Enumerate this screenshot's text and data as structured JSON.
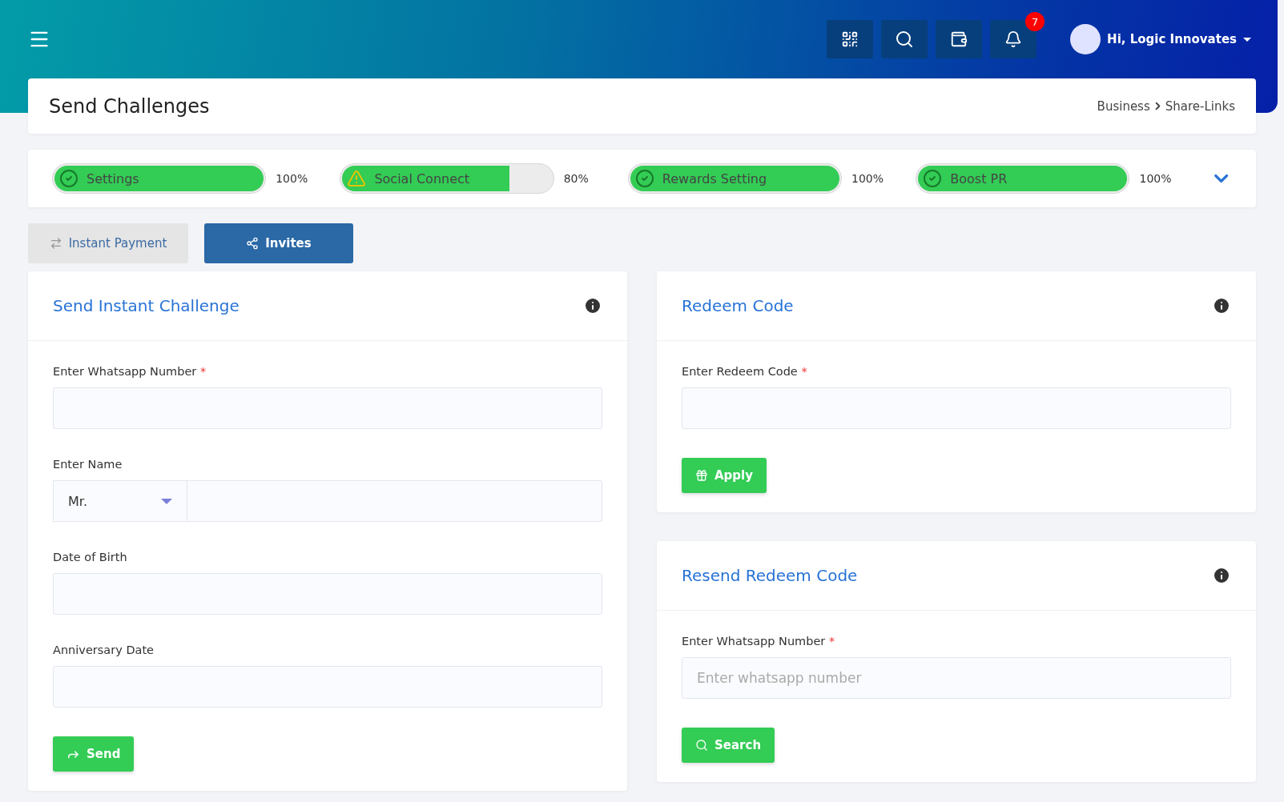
{
  "header": {
    "user": "Hi, Logic Innovates",
    "notifications": "7"
  },
  "page": {
    "title": "Send Challenges",
    "breadcrumb": [
      "Business",
      "Share-Links"
    ]
  },
  "progress": [
    {
      "label": "Settings",
      "kind": "ok",
      "level": 1,
      "reading": "100%"
    },
    {
      "label": "Social Connect",
      "kind": "warning",
      "level": 0.8,
      "reading": "80%"
    },
    {
      "label": "Rewards Setting",
      "kind": "ok",
      "level": 1,
      "reading": "100%"
    },
    {
      "label": "Boost PR",
      "kind": "ok",
      "level": 1,
      "reading": "100%"
    }
  ],
  "tabs": [
    {
      "label": "Instant Payment",
      "kind": "payment",
      "selected": false
    },
    {
      "label": "Invites",
      "kind": "share",
      "selected": true
    }
  ],
  "columns": [
    [
      {
        "title": "Send Instant Challenge",
        "fields": [
          {
            "kind": "text",
            "label": "Enter Whatsapp Number",
            "required": "*"
          },
          {
            "kind": "name",
            "label": "Enter Name",
            "select": "Mr."
          },
          {
            "kind": "text",
            "label": "Date of Birth"
          },
          {
            "kind": "text",
            "label": "Anniversary Date"
          }
        ],
        "button": {
          "label": "Send",
          "kind": "send"
        }
      }
    ],
    [
      {
        "title": "Redeem Code",
        "fields": [
          {
            "kind": "text",
            "label": "Enter Redeem Code",
            "required": "*"
          }
        ],
        "button": {
          "label": "Apply",
          "kind": "gift"
        }
      },
      {
        "title": "Resend Redeem Code",
        "fields": [
          {
            "kind": "text",
            "label": "Enter Whatsapp Number",
            "required": "*",
            "placeholder": "Enter whatsapp number"
          }
        ],
        "button": {
          "label": "Search",
          "kind": "search"
        }
      }
    ]
  ]
}
